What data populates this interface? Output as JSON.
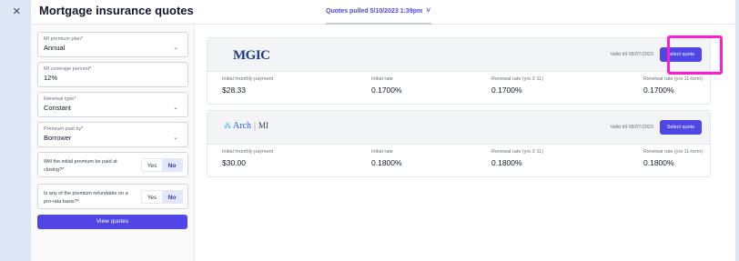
{
  "header": {
    "close_glyph": "×",
    "title": "Mortgage insurance quotes",
    "pulled": "Quotes pulled 5/10/2023 1:39pm",
    "chevron": "˅"
  },
  "sidebar": {
    "premium_plan": {
      "label": "MI premium plan*",
      "value": "Annual"
    },
    "coverage": {
      "label": "MI coverage percent*",
      "value": "12%"
    },
    "renewal": {
      "label": "Renewal type*",
      "value": "Constant"
    },
    "paid_by": {
      "label": "Premium paid by*",
      "value": "Borrower"
    },
    "q_closing": {
      "question": "Will the initial premium be paid at closing?*",
      "yes": "Yes",
      "no": "No"
    },
    "q_refund": {
      "question": "Is any of the premium refundable on a pro-rata basis?*",
      "yes": "Yes",
      "no": "No"
    },
    "caret": "⌄",
    "view_button": "View quotes"
  },
  "quotes": [
    {
      "logo": "MGIC",
      "valid": "Valid till 08/07/2023",
      "select": "Select quote",
      "cols": [
        {
          "label": "Initial monthly payment",
          "value": "$28.33"
        },
        {
          "label": "Initial rate",
          "value": "0.1700%"
        },
        {
          "label": "Renewal rate (yrs 2-11)",
          "value": "0.1700%"
        },
        {
          "label": "Renewal rate (yrs 11-term)",
          "value": "0.1700%"
        }
      ]
    },
    {
      "logo": "Arch",
      "logo_sep": "|",
      "logo_mi": "MI",
      "valid": "Valid till 08/07/2023",
      "select": "Select quote",
      "cols": [
        {
          "label": "Initial monthly payment",
          "value": "$30.00"
        },
        {
          "label": "Initial rate",
          "value": "0.1800%"
        },
        {
          "label": "Renewal rate (yrs 2-11)",
          "value": "0.1800%"
        },
        {
          "label": "Renewal rate (yrs 11-term)",
          "value": "0.1800%"
        }
      ]
    }
  ],
  "colors": {
    "accent": "#4f46e5",
    "highlight": "#ff1ecf",
    "background": "#dde7f5"
  }
}
